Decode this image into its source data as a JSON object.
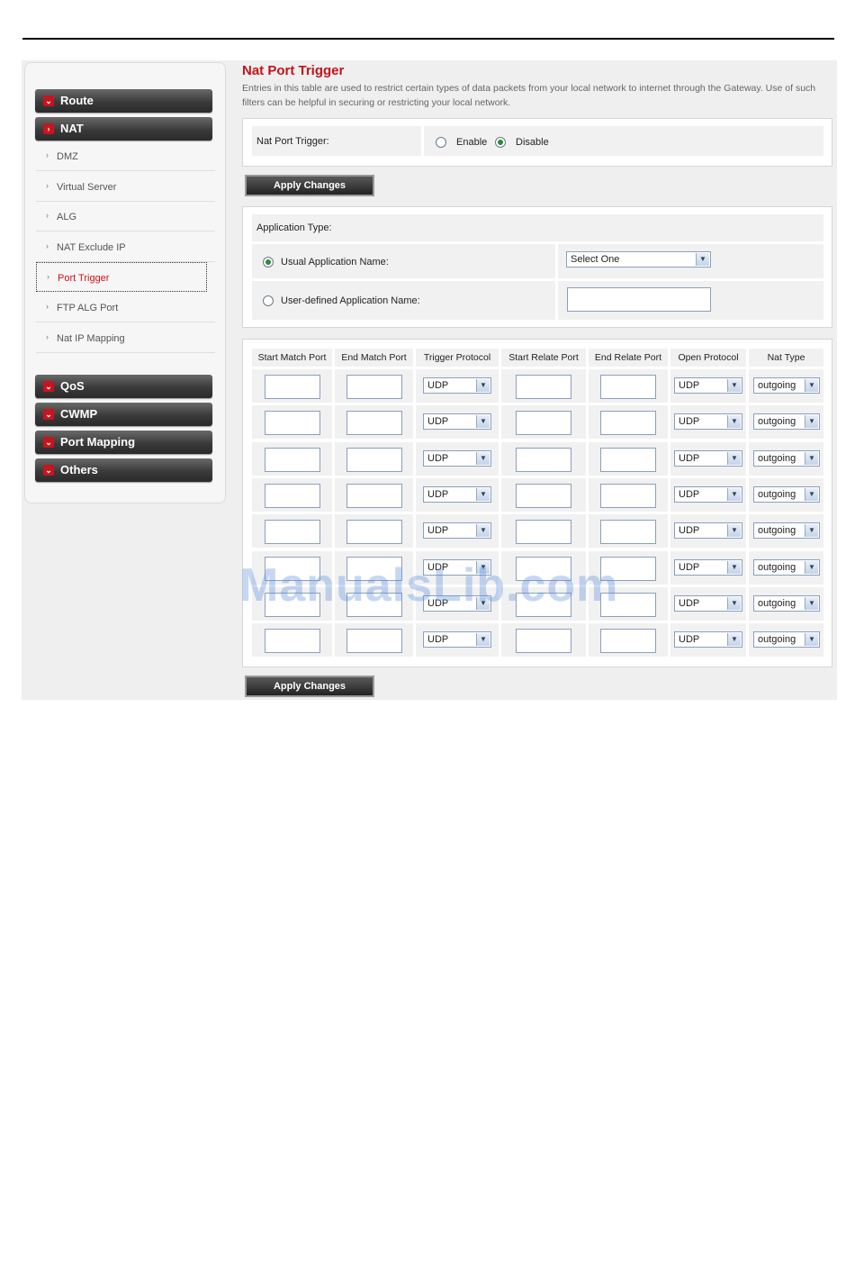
{
  "sidebar": {
    "top_buttons": [
      {
        "label": "Route",
        "icon": "chevron-down-icon"
      },
      {
        "label": "NAT",
        "icon": "chevron-right-icon"
      }
    ],
    "nat_items": [
      "DMZ",
      "Virtual Server",
      "ALG",
      "NAT Exclude IP",
      "Port Trigger",
      "FTP ALG Port",
      "Nat IP Mapping"
    ],
    "active_item": "Port Trigger",
    "bottom_buttons": [
      {
        "label": "QoS"
      },
      {
        "label": "CWMP"
      },
      {
        "label": "Port Mapping"
      },
      {
        "label": "Others"
      }
    ]
  },
  "main": {
    "title": "Nat Port Trigger",
    "description": "Entries in this table are used to restrict certain types of data packets from your local network to internet through the Gateway. Use of such filters can be helpful in securing or restricting your local network.",
    "trigger": {
      "label": "Nat Port Trigger:",
      "enable_label": "Enable",
      "disable_label": "Disable",
      "selected": "Disable"
    },
    "apply_label": "Apply Changes",
    "app_type": {
      "header": "Application Type:",
      "usual_label": "Usual Application Name:",
      "usual_selected": "Select One",
      "user_defined_label": "User-defined Application Name:",
      "user_defined_value": "",
      "selected": "usual"
    },
    "table": {
      "headers": [
        "Start Match Port",
        "End Match Port",
        "Trigger Protocol",
        "Start Relate Port",
        "End Relate Port",
        "Open Protocol",
        "Nat Type"
      ],
      "rows": [
        {
          "start_match": "",
          "end_match": "",
          "trigger_protocol": "UDP",
          "start_relate": "",
          "end_relate": "",
          "open_protocol": "UDP",
          "nat_type": "outgoing"
        },
        {
          "start_match": "",
          "end_match": "",
          "trigger_protocol": "UDP",
          "start_relate": "",
          "end_relate": "",
          "open_protocol": "UDP",
          "nat_type": "outgoing"
        },
        {
          "start_match": "",
          "end_match": "",
          "trigger_protocol": "UDP",
          "start_relate": "",
          "end_relate": "",
          "open_protocol": "UDP",
          "nat_type": "outgoing"
        },
        {
          "start_match": "",
          "end_match": "",
          "trigger_protocol": "UDP",
          "start_relate": "",
          "end_relate": "",
          "open_protocol": "UDP",
          "nat_type": "outgoing"
        },
        {
          "start_match": "",
          "end_match": "",
          "trigger_protocol": "UDP",
          "start_relate": "",
          "end_relate": "",
          "open_protocol": "UDP",
          "nat_type": "outgoing"
        },
        {
          "start_match": "",
          "end_match": "",
          "trigger_protocol": "UDP",
          "start_relate": "",
          "end_relate": "",
          "open_protocol": "UDP",
          "nat_type": "outgoing"
        },
        {
          "start_match": "",
          "end_match": "",
          "trigger_protocol": "UDP",
          "start_relate": "",
          "end_relate": "",
          "open_protocol": "UDP",
          "nat_type": "outgoing"
        },
        {
          "start_match": "",
          "end_match": "",
          "trigger_protocol": "UDP",
          "start_relate": "",
          "end_relate": "",
          "open_protocol": "UDP",
          "nat_type": "outgoing"
        }
      ]
    }
  },
  "watermark": "ManualsLib.com",
  "colors": {
    "accent": "#c4121a",
    "menu_dark": "#2a2a2a",
    "panel_gray": "#f1f1f1"
  }
}
